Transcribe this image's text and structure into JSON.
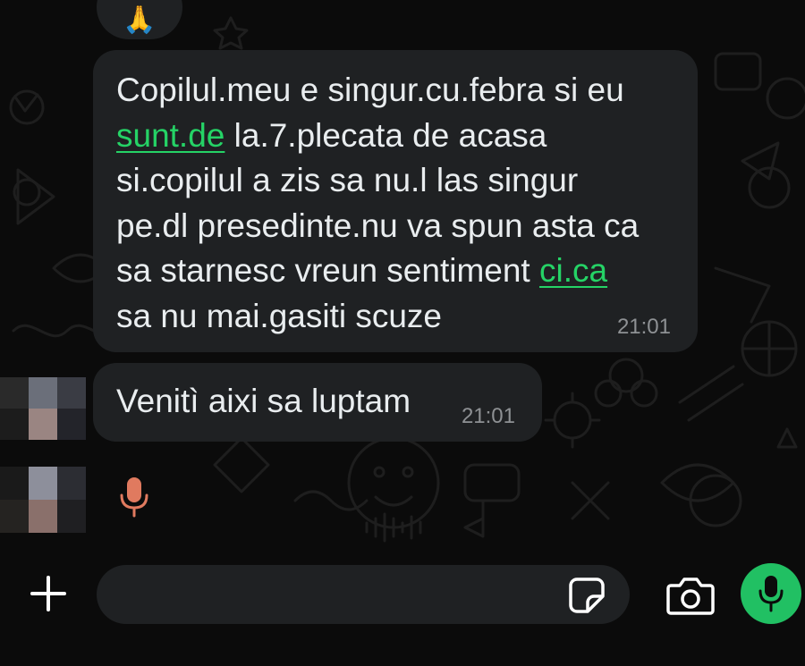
{
  "reaction": {
    "emoji": "🙏"
  },
  "messages": [
    {
      "lines": [
        [
          {
            "text": "Copilul.meu e singur.cu.febra si eu",
            "link": false
          }
        ],
        [
          {
            "text": "sunt.de",
            "link": true
          },
          {
            "text": " la.7.plecata de acasa",
            "link": false
          }
        ],
        [
          {
            "text": "si.copilul a zis sa nu.l las singur",
            "link": false
          }
        ],
        [
          {
            "text": "pe.dl presedinte.nu va spun asta ca",
            "link": false
          }
        ],
        [
          {
            "text": "sa starnesc vreun sentiment ",
            "link": false
          },
          {
            "text": "ci.ca",
            "link": true
          }
        ],
        [
          {
            "text": "sa nu mai.gasiti scuze",
            "link": false
          }
        ]
      ],
      "time": "21:01"
    },
    {
      "lines": [
        [
          {
            "text": "Venitì aixi sa luptam",
            "link": false
          }
        ]
      ],
      "time": "21:01"
    }
  ],
  "input": {
    "placeholder": ""
  },
  "icons": {
    "attach": "plus-icon",
    "sticker": "sticker-icon",
    "camera": "camera-icon",
    "mic": "microphone-icon",
    "voice_note": "voice-note-mic-icon"
  },
  "colors": {
    "background": "#0b0b0b",
    "bubble": "#1f2123",
    "text": "#e9edef",
    "timestamp": "#8e9194",
    "link": "#25d366",
    "send_button": "#21c063",
    "voice_mic": "#e07a5f"
  }
}
